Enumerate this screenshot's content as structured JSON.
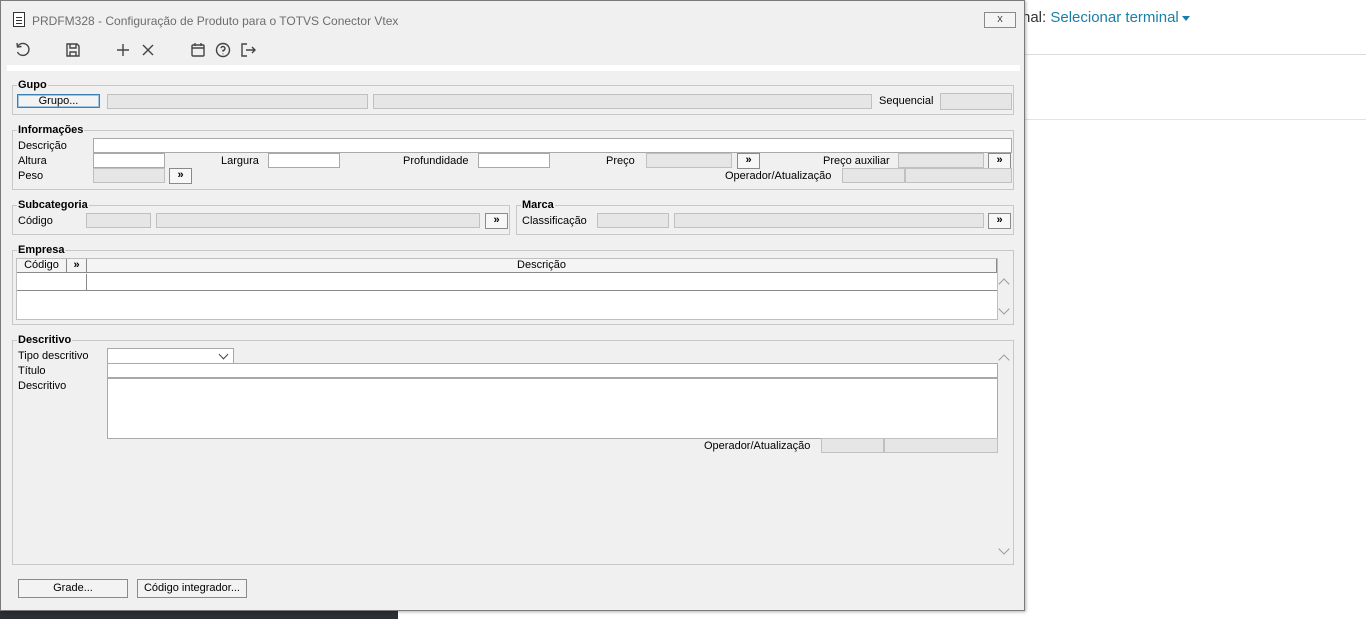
{
  "background": {
    "terminal_prefix": "nal:",
    "terminal_link": "Selecionar terminal"
  },
  "window": {
    "title": "PRDFM328 - Configuração de Produto para o TOTVS Conector Vtex",
    "close_label": "x"
  },
  "toolbar": {
    "icons": [
      "undo-icon",
      "save-icon",
      "add-icon",
      "delete-icon",
      "calendar-icon",
      "help-icon",
      "exit-icon"
    ]
  },
  "grupo": {
    "title": "Gupo",
    "button": "Grupo...",
    "sequencial_label": "Sequencial"
  },
  "informacoes": {
    "title": "Informações",
    "descricao_label": "Descrição",
    "altura_label": "Altura",
    "largura_label": "Largura",
    "profundidade_label": "Profundidade",
    "preco_label": "Preço",
    "preco_aux_label": "Preço auxiliar",
    "peso_label": "Peso",
    "operador_label": "Operador/Atualização",
    "lookup": "»"
  },
  "subcategoria": {
    "title": "Subcategoria",
    "codigo_label": "Código",
    "lookup": "»"
  },
  "marca": {
    "title": "Marca",
    "classificacao_label": "Classificação",
    "lookup": "»"
  },
  "empresa": {
    "title": "Empresa",
    "columns": [
      "Código",
      "»",
      "Descrição"
    ]
  },
  "descritivo": {
    "title": "Descritivo",
    "tipo_label": "Tipo descritivo",
    "titulo_label": "Título",
    "descritivo_label": "Descritivo",
    "operador_label": "Operador/Atualização"
  },
  "footer": {
    "grade_button": "Grade...",
    "codigo_integrador_button": "Código integrador..."
  }
}
